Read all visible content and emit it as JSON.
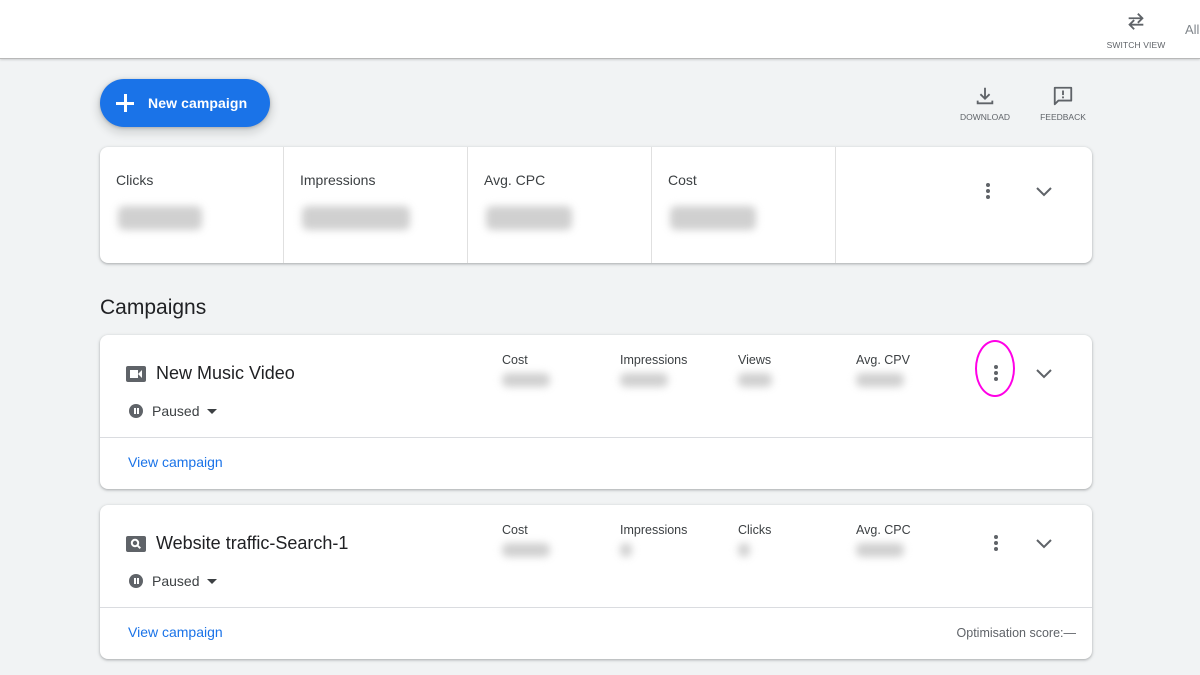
{
  "topbar": {
    "switch_view_label": "SWITCH VIEW",
    "all_label": "All"
  },
  "toolbar": {
    "new_campaign_label": "New campaign",
    "download_label": "DOWNLOAD",
    "feedback_label": "FEEDBACK"
  },
  "summary": {
    "metrics": [
      {
        "label": "Clicks",
        "value": "(blurred)"
      },
      {
        "label": "Impressions",
        "value": "(blurred)"
      },
      {
        "label": "Avg. CPC",
        "value": "(blurred)"
      },
      {
        "label": "Cost",
        "value": "(blurred)"
      }
    ]
  },
  "campaigns_title": "Campaigns",
  "campaigns": [
    {
      "name": "New Music Video",
      "type_icon": "video-camera-icon",
      "status": "Paused",
      "metrics": [
        {
          "label": "Cost",
          "value": "(blurred)"
        },
        {
          "label": "Impressions",
          "value": "(blurred)"
        },
        {
          "label": "Views",
          "value": "(blurred)"
        },
        {
          "label": "Avg. CPV",
          "value": "(blurred)"
        }
      ],
      "link_label": "View campaign",
      "optimisation_score": null,
      "menu_highlighted": true
    },
    {
      "name": "Website traffic-Search-1",
      "type_icon": "search-icon",
      "status": "Paused",
      "metrics": [
        {
          "label": "Cost",
          "value": "(blurred)"
        },
        {
          "label": "Impressions",
          "value": "(blurred)"
        },
        {
          "label": "Clicks",
          "value": "(blurred)"
        },
        {
          "label": "Avg. CPC",
          "value": "(blurred)"
        }
      ],
      "link_label": "View campaign",
      "optimisation_score": "Optimisation score:—",
      "menu_highlighted": false
    }
  ],
  "colors": {
    "accent": "#1a73e8",
    "highlight": "#ff00e6",
    "background": "#f1f3f4"
  }
}
